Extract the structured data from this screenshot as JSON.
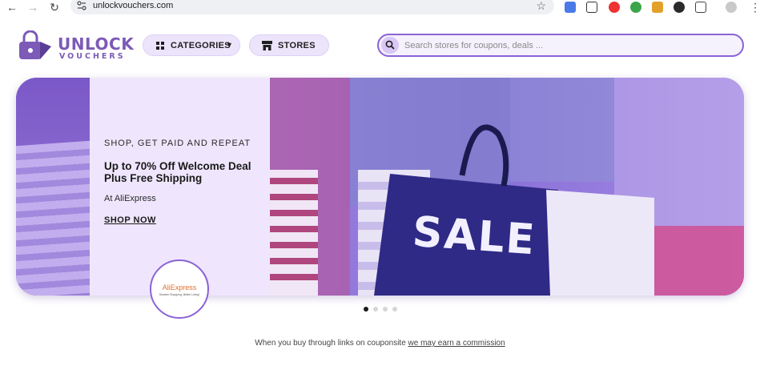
{
  "browser": {
    "url": "unlockvouchers.com"
  },
  "header": {
    "logo_top": "UNLOCK",
    "logo_bottom": "VOUCHERS",
    "categories_label": "CATEGORIES",
    "stores_label": "STORES",
    "search_placeholder": "Search stores for coupons, deals ..."
  },
  "hero": {
    "tagline": "SHOP, GET PAID AND REPEAT",
    "title": "Up to 70% Off Welcome Deal Plus Free Shipping",
    "store_line": "At AliExpress",
    "cta": "SHOP NOW",
    "store_logo_name": "AliExpress",
    "store_logo_sub": "Smarter Shopping, Better Living!",
    "photo_text": "SALE",
    "slide_count": 4,
    "active_slide": 1
  },
  "footer_note": {
    "prefix": "When you buy through links on couponsite ",
    "link": "we may earn a commission"
  },
  "colors": {
    "brand_purple": "#7c5ab8",
    "accent_purple": "#8b63d6",
    "panel_lavender": "#efe6fd",
    "aliexpress_orange": "#e4702b"
  }
}
